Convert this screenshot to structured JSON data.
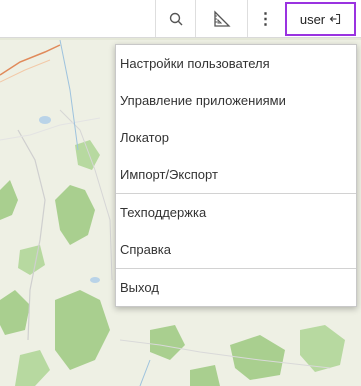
{
  "toolbar": {
    "search_icon": "search-icon",
    "ruler_icon": "ruler-icon",
    "more_icon": "more-vertical-icon",
    "more_glyph": "⋮",
    "user_label": "user",
    "logout_icon": "logout-icon"
  },
  "menu": {
    "items": [
      {
        "label": "Настройки пользователя"
      },
      {
        "label": "Управление приложениями"
      },
      {
        "label": "Локатор"
      },
      {
        "label": "Импорт/Экспорт"
      },
      {
        "label": "Техподдержка"
      },
      {
        "label": "Справка"
      },
      {
        "label": "Выход"
      }
    ]
  },
  "colors": {
    "user_highlight": "#9a33e0",
    "map_background": "#eef0e4",
    "forest": "#a9cf8f",
    "road": "#e08a5a"
  }
}
